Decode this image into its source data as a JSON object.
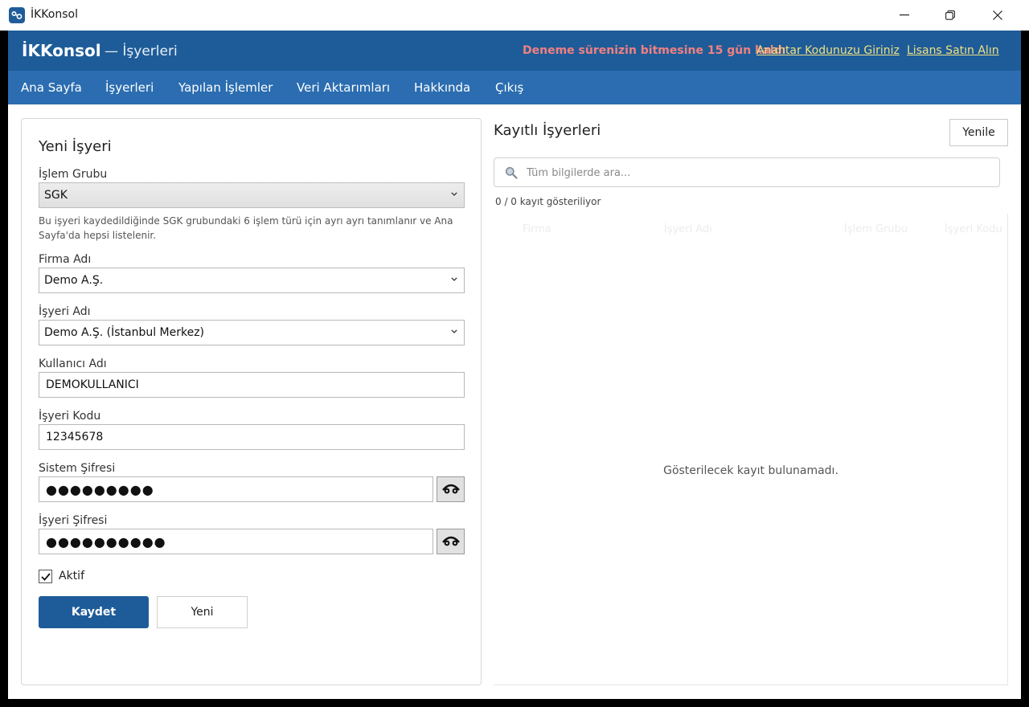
{
  "window": {
    "title": "İKKonsol"
  },
  "header": {
    "brand": "İKKonsol",
    "subtitle": "— İşyerleri",
    "trial_notice": "Deneme sürenizin bitmesine 15 gün kaldı",
    "license_key_link": "Anahtar Kodunuzu Giriniz",
    "buy_license_link": "Lisans Satın Alın"
  },
  "nav": [
    {
      "label": "Ana Sayfa"
    },
    {
      "label": "İşyerleri"
    },
    {
      "label": "Yapılan İşlemler"
    },
    {
      "label": "Veri Aktarımları"
    },
    {
      "label": "Hakkında"
    },
    {
      "label": "Çıkış"
    }
  ],
  "form": {
    "title": "Yeni İşyeri",
    "group_label": "İşlem Grubu",
    "group_value": "SGK",
    "group_hint": "Bu işyeri kaydedildiğinde SGK grubundaki 6 işlem türü için ayrı ayrı tanımlanır ve Ana Sayfa'da hepsi listelenir.",
    "company_label": "Firma Adı",
    "company_value": "Demo A.Ş.",
    "workplace_label": "İşyeri Adı",
    "workplace_value": "Demo A.Ş. (İstanbul Merkez)",
    "username_label": "Kullanıcı Adı",
    "username_value": "DEMOKULLANICI",
    "code_label": "İşyeri Kodu",
    "code_value": "12345678",
    "system_pwd_label": "Sistem Şifresi",
    "system_pwd_masked": "●●●●●●●●●",
    "workplace_pwd_label": "İşyeri Şifresi",
    "workplace_pwd_masked": "●●●●●●●●●●",
    "active_label": "Aktif",
    "active_checked": true,
    "save_label": "Kaydet",
    "new_label": "Yeni"
  },
  "list": {
    "title": "Kayıtlı İşyerleri",
    "refresh_label": "Yenile",
    "search_placeholder": "Tüm bilgilerde ara...",
    "count_text": "0 / 0 kayıt gösteriliyor",
    "columns": [
      "Firma",
      "İşyeri Adı",
      "İşlem Grubu",
      "İşyeri Kodu"
    ],
    "empty_text": "Gösterilecek kayıt bulunamadı."
  },
  "colors": {
    "header_bg": "#1e5c99",
    "nav_bg": "#2b6db0",
    "trial_text": "#f08080",
    "link_text": "#f0e080",
    "primary_button": "#1e5c99"
  },
  "icons": {
    "app": "link-icon",
    "minimize": "minimize-icon",
    "restore": "restore-icon",
    "close": "close-icon",
    "chevron": "chevron-down-icon",
    "eye": "eye-toggle-icon",
    "search": "search-icon",
    "check": "checkmark-icon"
  }
}
